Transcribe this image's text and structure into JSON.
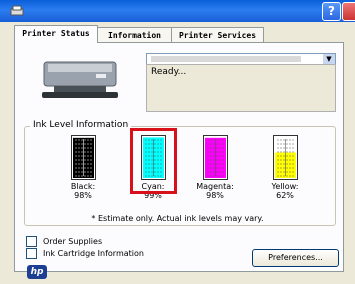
{
  "window": {
    "help_label": "?"
  },
  "tabs": [
    {
      "label": "Printer Status",
      "active": true
    },
    {
      "label": "Information",
      "active": false
    },
    {
      "label": "Printer Services",
      "active": false
    }
  ],
  "status": {
    "text": "Ready..."
  },
  "ink": {
    "group_title": "Ink Level Information",
    "cartridges": [
      {
        "name": "Black:",
        "percent": "98%",
        "level": 0.98,
        "color": "#000000"
      },
      {
        "name": "Cyan:",
        "percent": "99%",
        "level": 0.99,
        "color": "#00ffff"
      },
      {
        "name": "Magenta:",
        "percent": "98%",
        "level": 0.98,
        "color": "#ff00ff"
      },
      {
        "name": "Yellow:",
        "percent": "62%",
        "level": 0.62,
        "color": "#ffff00"
      }
    ],
    "note": "* Estimate only. Actual ink levels may vary.",
    "highlight_color": "#d8101a"
  },
  "links": {
    "order_supplies": "Order Supplies",
    "cartridge_info": "Ink Cartridge Information"
  },
  "buttons": {
    "preferences": "Preferences..."
  },
  "logo": {
    "text": "hp"
  }
}
